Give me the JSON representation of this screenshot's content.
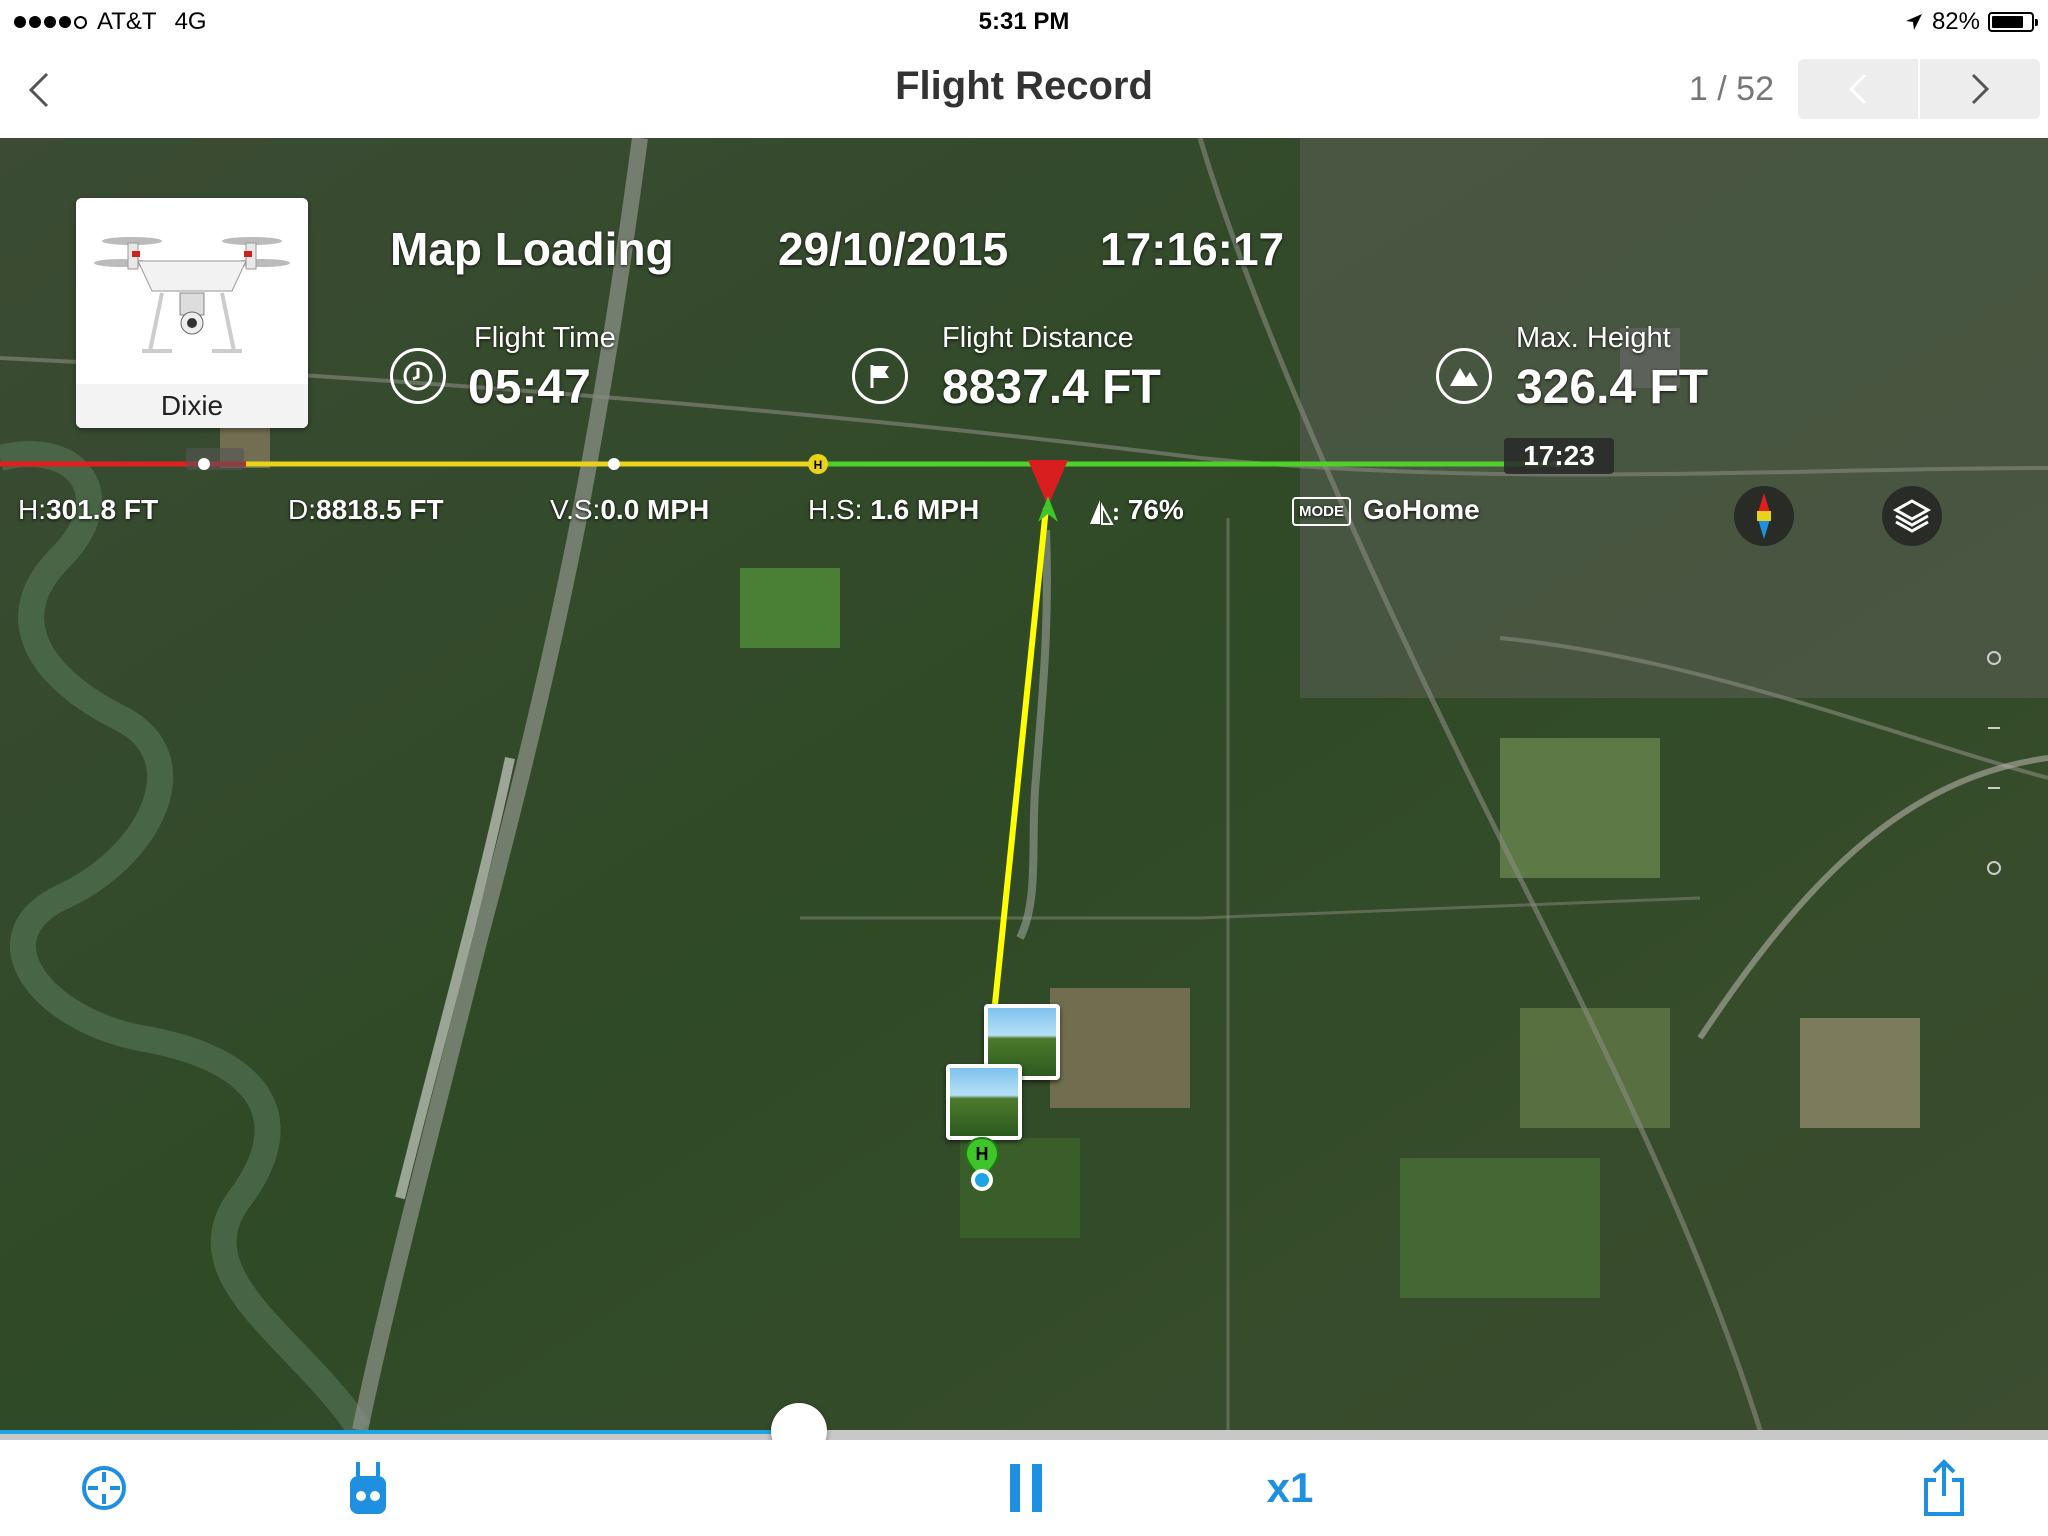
{
  "status_bar": {
    "carrier": "AT&T",
    "network": "4G",
    "time": "5:31 PM",
    "battery": "82%",
    "battery_level": 0.82
  },
  "nav": {
    "title": "Flight Record",
    "page_counter": "1 / 52"
  },
  "header": {
    "aircraft_name": "Dixie",
    "location": "Map Loading",
    "date": "29/10/2015",
    "time": "17:16:17"
  },
  "stats": {
    "flight_time_label": "Flight Time",
    "flight_time_value": "05:47",
    "flight_distance_label": "Flight Distance",
    "flight_distance_value": "8837.4 FT",
    "max_height_label": "Max. Height",
    "max_height_value": "326.4 FT"
  },
  "timeline_tag": "17:23",
  "telemetry": {
    "h_label": "H:",
    "h_value": "301.8 FT",
    "d_label": "D:",
    "d_value": "8818.5 FT",
    "vs_label": "V.S:",
    "vs_value": "0.0 MPH",
    "hs_label": "H.S:",
    "hs_value": "1.6 MPH",
    "battery_value": "76%",
    "mode_badge": "MODE",
    "mode_value": "GoHome"
  },
  "playback": {
    "speed": "x1",
    "progress": 0.39
  },
  "colors": {
    "accent": "#1f8fe0",
    "flight_path": "#ffff00",
    "track_red": "#e02020",
    "track_yellow": "#e8d21a",
    "track_green": "#4fd12a"
  },
  "icons": {
    "back": "chevron-left-icon",
    "prev": "chevron-left-icon",
    "next": "chevron-right-icon",
    "flight_time": "clock-icon",
    "flight_distance": "flag-icon",
    "max_height": "mountain-icon",
    "compass": "compass-icon",
    "layers": "layers-icon",
    "locate": "crosshair-icon",
    "controller": "remote-controller-icon",
    "pause": "pause-icon",
    "share": "share-icon"
  }
}
